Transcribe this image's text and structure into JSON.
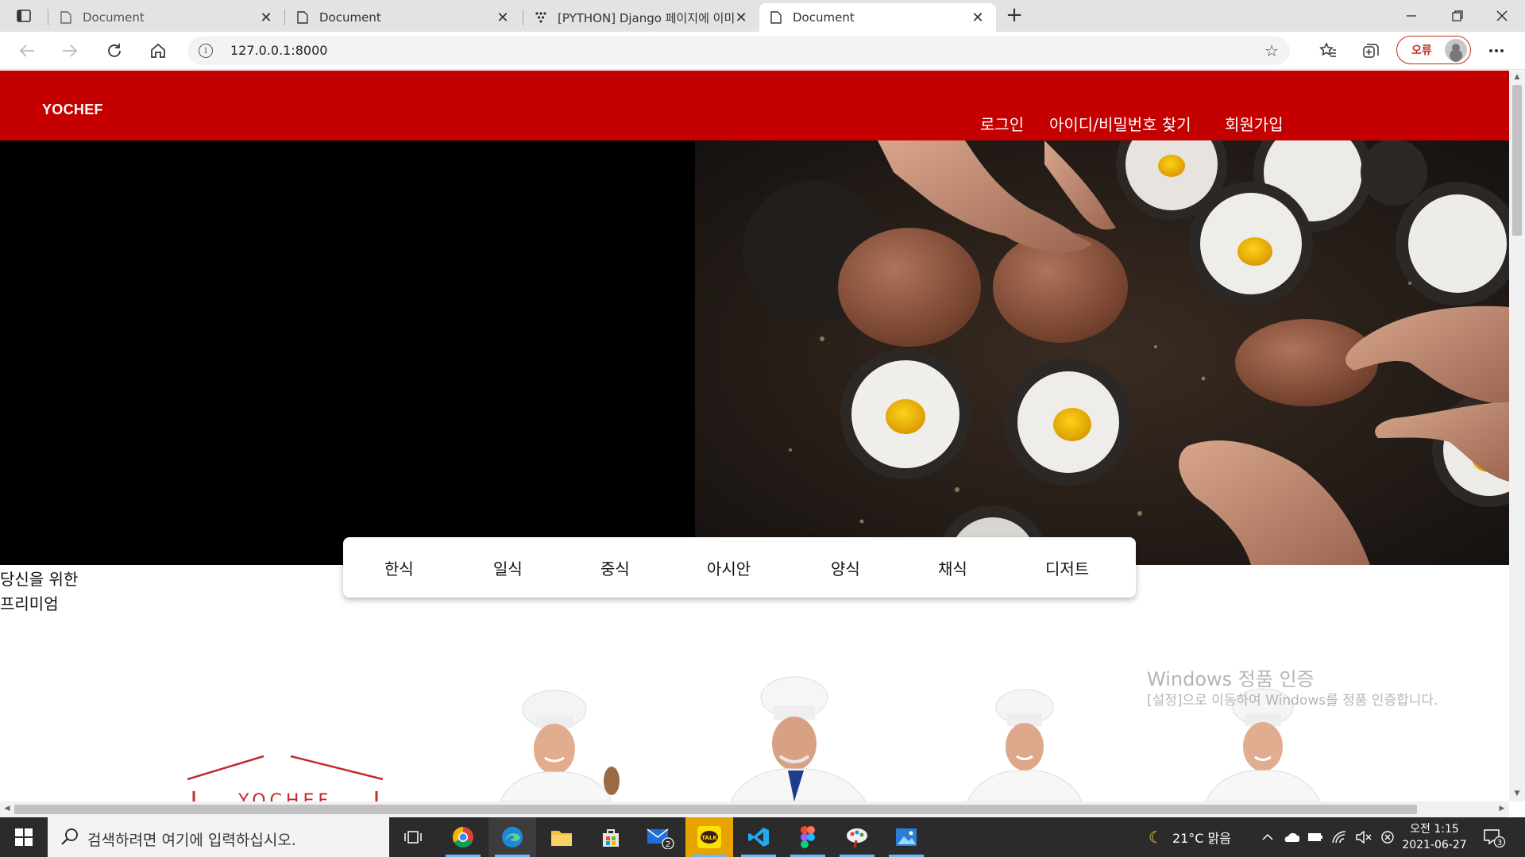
{
  "browser": {
    "tabs": [
      {
        "title": "Document",
        "active": false
      },
      {
        "title": "Document",
        "active": false
      },
      {
        "title": "[PYTHON] Django 페이지에 이미",
        "active": false
      },
      {
        "title": "Document",
        "active": true
      }
    ],
    "url": "127.0.0.1:8000",
    "error_label": "오류",
    "new_tab_symbol": "+"
  },
  "site": {
    "logo": "YOCHEF",
    "nav": [
      "로그인",
      "아이디/비밀번호 찾기",
      "회원가입"
    ],
    "categories": [
      "한식",
      "일식",
      "중식",
      "아시안",
      "양식",
      "채식",
      "디저트"
    ],
    "tagline": [
      "당신을 위한",
      "프리미엄"
    ],
    "house_logo_text": "YOCHEF"
  },
  "watermark": {
    "line1": "Windows 정품 인증",
    "line2": "[설정]으로 이동하여 Windows를 정품 인증합니다."
  },
  "taskbar": {
    "search_placeholder": "검색하려면 여기에 입력하십시오.",
    "weather": "21°C  맑음",
    "time": "오전 1:15",
    "date": "2021-06-27",
    "mail_badge": "2",
    "notification_badge": "3"
  },
  "colors": {
    "brand_red": "#c40000",
    "taskbar": "#2b2b2b"
  }
}
